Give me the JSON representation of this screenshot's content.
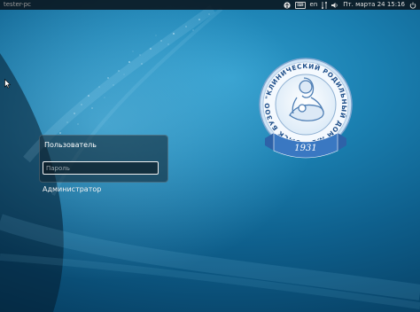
{
  "topbar": {
    "hostname": "tester-pc",
    "keyboard_layout": "en",
    "datetime": "Пт. марта 24  15:16",
    "icons": [
      "accessibility-icon",
      "keyboard-icon",
      "network-icon",
      "volume-icon",
      "power-icon"
    ]
  },
  "login": {
    "selected_user": "Пользователь",
    "password_placeholder": "Пароль",
    "password_value": "",
    "other_user": "Администратор"
  },
  "logo": {
    "inscription": "ОМСК БУЗОО \"КЛИНИЧЕСКИЙ РОДИЛЬНЫЙ ДОМ №1\"",
    "year": "1931",
    "colors": {
      "ring": "#b8d4ee",
      "ribbon": "#3a78c2",
      "text": "#ffffff"
    }
  },
  "colors": {
    "panel_bg": "rgba(15,30,40,0.55)",
    "wallpaper_center": "#2f9ccc",
    "wallpaper_edge": "#063a5c"
  }
}
